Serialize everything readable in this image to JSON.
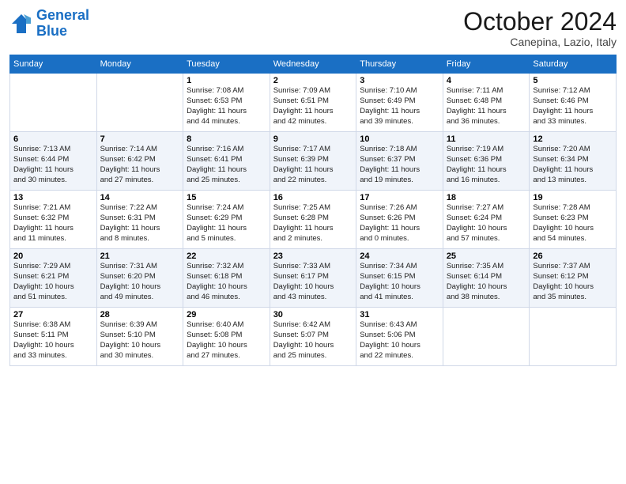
{
  "header": {
    "logo_line1": "General",
    "logo_line2": "Blue",
    "month": "October 2024",
    "location": "Canepina, Lazio, Italy"
  },
  "days_of_week": [
    "Sunday",
    "Monday",
    "Tuesday",
    "Wednesday",
    "Thursday",
    "Friday",
    "Saturday"
  ],
  "weeks": [
    [
      null,
      null,
      {
        "day": 1,
        "lines": [
          "Sunrise: 7:08 AM",
          "Sunset: 6:53 PM",
          "Daylight: 11 hours",
          "and 44 minutes."
        ]
      },
      {
        "day": 2,
        "lines": [
          "Sunrise: 7:09 AM",
          "Sunset: 6:51 PM",
          "Daylight: 11 hours",
          "and 42 minutes."
        ]
      },
      {
        "day": 3,
        "lines": [
          "Sunrise: 7:10 AM",
          "Sunset: 6:49 PM",
          "Daylight: 11 hours",
          "and 39 minutes."
        ]
      },
      {
        "day": 4,
        "lines": [
          "Sunrise: 7:11 AM",
          "Sunset: 6:48 PM",
          "Daylight: 11 hours",
          "and 36 minutes."
        ]
      },
      {
        "day": 5,
        "lines": [
          "Sunrise: 7:12 AM",
          "Sunset: 6:46 PM",
          "Daylight: 11 hours",
          "and 33 minutes."
        ]
      }
    ],
    [
      {
        "day": 6,
        "lines": [
          "Sunrise: 7:13 AM",
          "Sunset: 6:44 PM",
          "Daylight: 11 hours",
          "and 30 minutes."
        ]
      },
      {
        "day": 7,
        "lines": [
          "Sunrise: 7:14 AM",
          "Sunset: 6:42 PM",
          "Daylight: 11 hours",
          "and 27 minutes."
        ]
      },
      {
        "day": 8,
        "lines": [
          "Sunrise: 7:16 AM",
          "Sunset: 6:41 PM",
          "Daylight: 11 hours",
          "and 25 minutes."
        ]
      },
      {
        "day": 9,
        "lines": [
          "Sunrise: 7:17 AM",
          "Sunset: 6:39 PM",
          "Daylight: 11 hours",
          "and 22 minutes."
        ]
      },
      {
        "day": 10,
        "lines": [
          "Sunrise: 7:18 AM",
          "Sunset: 6:37 PM",
          "Daylight: 11 hours",
          "and 19 minutes."
        ]
      },
      {
        "day": 11,
        "lines": [
          "Sunrise: 7:19 AM",
          "Sunset: 6:36 PM",
          "Daylight: 11 hours",
          "and 16 minutes."
        ]
      },
      {
        "day": 12,
        "lines": [
          "Sunrise: 7:20 AM",
          "Sunset: 6:34 PM",
          "Daylight: 11 hours",
          "and 13 minutes."
        ]
      }
    ],
    [
      {
        "day": 13,
        "lines": [
          "Sunrise: 7:21 AM",
          "Sunset: 6:32 PM",
          "Daylight: 11 hours",
          "and 11 minutes."
        ]
      },
      {
        "day": 14,
        "lines": [
          "Sunrise: 7:22 AM",
          "Sunset: 6:31 PM",
          "Daylight: 11 hours",
          "and 8 minutes."
        ]
      },
      {
        "day": 15,
        "lines": [
          "Sunrise: 7:24 AM",
          "Sunset: 6:29 PM",
          "Daylight: 11 hours",
          "and 5 minutes."
        ]
      },
      {
        "day": 16,
        "lines": [
          "Sunrise: 7:25 AM",
          "Sunset: 6:28 PM",
          "Daylight: 11 hours",
          "and 2 minutes."
        ]
      },
      {
        "day": 17,
        "lines": [
          "Sunrise: 7:26 AM",
          "Sunset: 6:26 PM",
          "Daylight: 11 hours",
          "and 0 minutes."
        ]
      },
      {
        "day": 18,
        "lines": [
          "Sunrise: 7:27 AM",
          "Sunset: 6:24 PM",
          "Daylight: 10 hours",
          "and 57 minutes."
        ]
      },
      {
        "day": 19,
        "lines": [
          "Sunrise: 7:28 AM",
          "Sunset: 6:23 PM",
          "Daylight: 10 hours",
          "and 54 minutes."
        ]
      }
    ],
    [
      {
        "day": 20,
        "lines": [
          "Sunrise: 7:29 AM",
          "Sunset: 6:21 PM",
          "Daylight: 10 hours",
          "and 51 minutes."
        ]
      },
      {
        "day": 21,
        "lines": [
          "Sunrise: 7:31 AM",
          "Sunset: 6:20 PM",
          "Daylight: 10 hours",
          "and 49 minutes."
        ]
      },
      {
        "day": 22,
        "lines": [
          "Sunrise: 7:32 AM",
          "Sunset: 6:18 PM",
          "Daylight: 10 hours",
          "and 46 minutes."
        ]
      },
      {
        "day": 23,
        "lines": [
          "Sunrise: 7:33 AM",
          "Sunset: 6:17 PM",
          "Daylight: 10 hours",
          "and 43 minutes."
        ]
      },
      {
        "day": 24,
        "lines": [
          "Sunrise: 7:34 AM",
          "Sunset: 6:15 PM",
          "Daylight: 10 hours",
          "and 41 minutes."
        ]
      },
      {
        "day": 25,
        "lines": [
          "Sunrise: 7:35 AM",
          "Sunset: 6:14 PM",
          "Daylight: 10 hours",
          "and 38 minutes."
        ]
      },
      {
        "day": 26,
        "lines": [
          "Sunrise: 7:37 AM",
          "Sunset: 6:12 PM",
          "Daylight: 10 hours",
          "and 35 minutes."
        ]
      }
    ],
    [
      {
        "day": 27,
        "lines": [
          "Sunrise: 6:38 AM",
          "Sunset: 5:11 PM",
          "Daylight: 10 hours",
          "and 33 minutes."
        ]
      },
      {
        "day": 28,
        "lines": [
          "Sunrise: 6:39 AM",
          "Sunset: 5:10 PM",
          "Daylight: 10 hours",
          "and 30 minutes."
        ]
      },
      {
        "day": 29,
        "lines": [
          "Sunrise: 6:40 AM",
          "Sunset: 5:08 PM",
          "Daylight: 10 hours",
          "and 27 minutes."
        ]
      },
      {
        "day": 30,
        "lines": [
          "Sunrise: 6:42 AM",
          "Sunset: 5:07 PM",
          "Daylight: 10 hours",
          "and 25 minutes."
        ]
      },
      {
        "day": 31,
        "lines": [
          "Sunrise: 6:43 AM",
          "Sunset: 5:06 PM",
          "Daylight: 10 hours",
          "and 22 minutes."
        ]
      },
      null,
      null
    ]
  ]
}
